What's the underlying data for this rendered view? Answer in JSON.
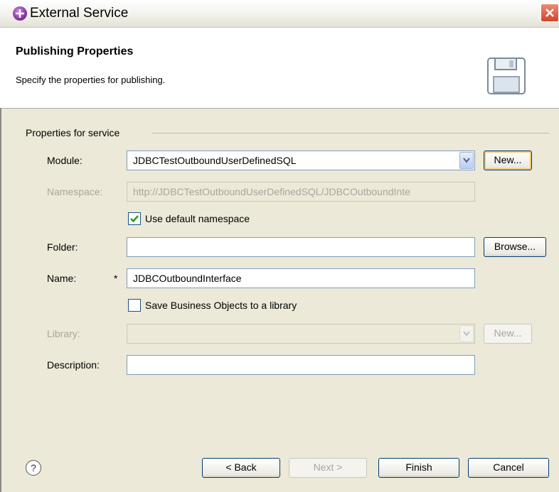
{
  "window": {
    "title": "External Service"
  },
  "banner": {
    "title": "Publishing Properties",
    "description": "Specify the properties for publishing."
  },
  "group": {
    "label": "Properties for service"
  },
  "form": {
    "module_label": "Module:",
    "module_value": "JDBCTestOutboundUserDefinedSQL",
    "module_new": "New...",
    "namespace_label": "Namespace:",
    "namespace_value": "http://JDBCTestOutboundUserDefinedSQL/JDBCOutboundInte",
    "use_default_ns_label": "Use default namespace",
    "use_default_ns_checked": true,
    "folder_label": "Folder:",
    "folder_value": "",
    "folder_browse": "Browse...",
    "name_label": "Name:",
    "name_required": "*",
    "name_value": "JDBCOutboundInterface",
    "save_bo_label": "Save Business Objects to a library",
    "save_bo_checked": false,
    "library_label": "Library:",
    "library_value": "",
    "library_new": "New...",
    "description_label": "Description:",
    "description_value": ""
  },
  "footer": {
    "help": "?",
    "back": "< Back",
    "next": "Next >",
    "finish": "Finish",
    "cancel": "Cancel"
  }
}
